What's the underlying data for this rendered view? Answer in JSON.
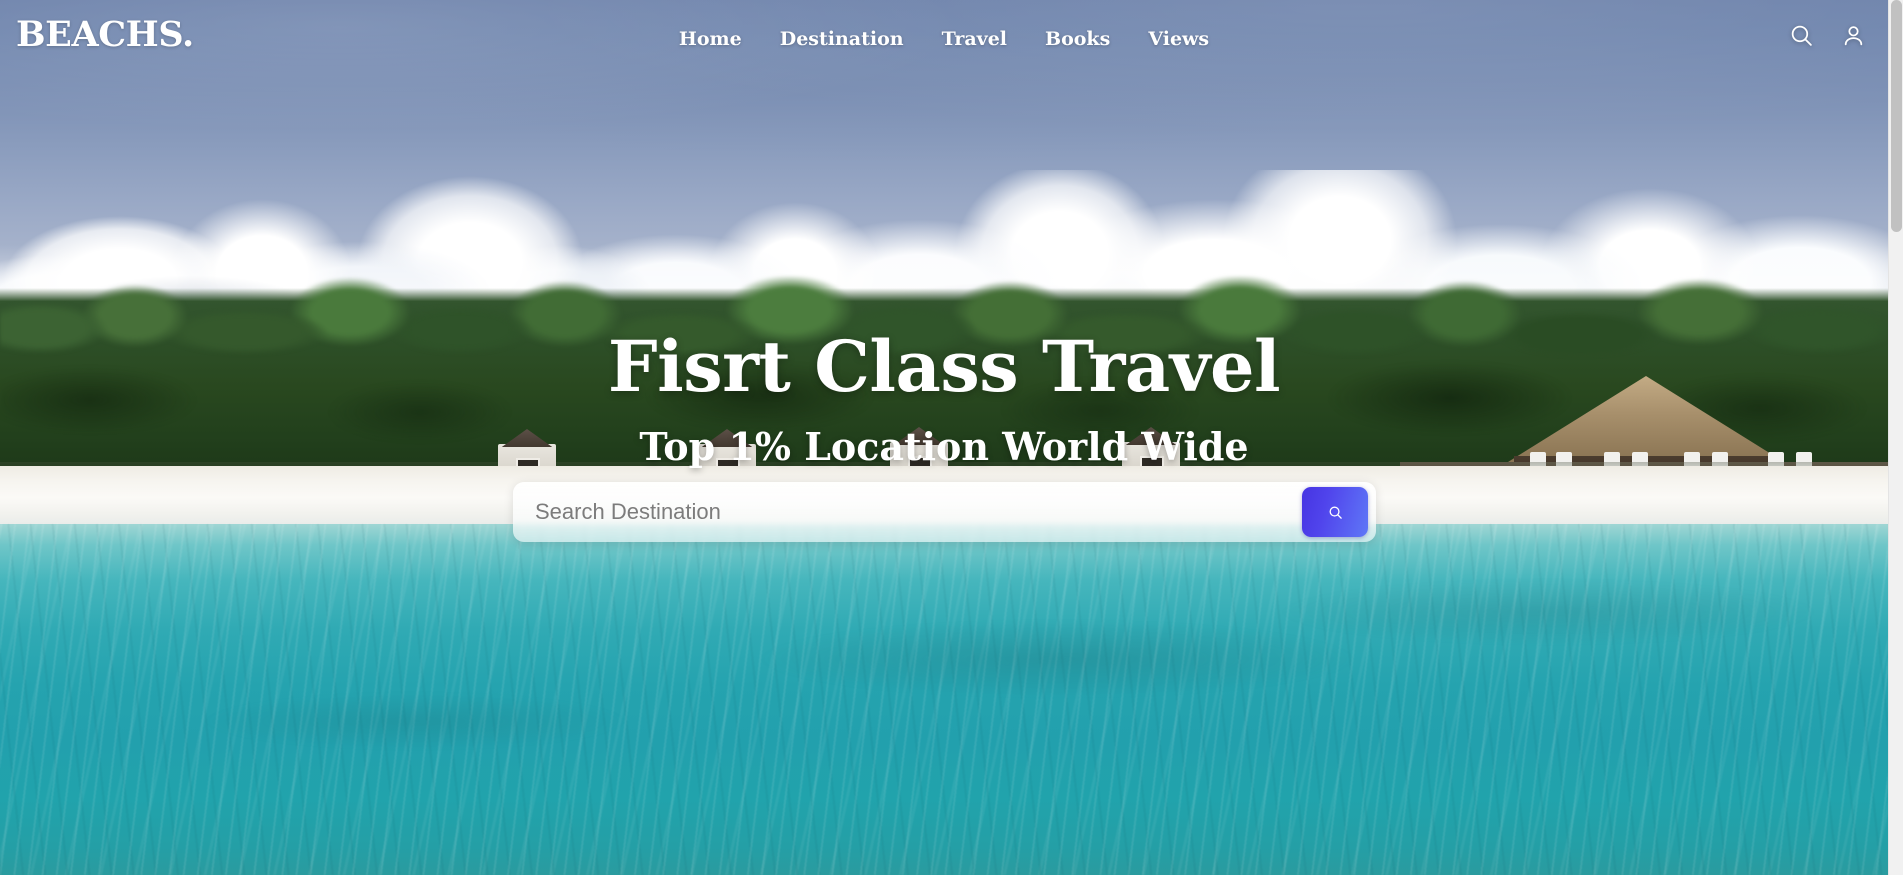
{
  "site": {
    "logo": "BEACHS."
  },
  "nav": {
    "items": [
      {
        "label": "Home"
      },
      {
        "label": "Destination"
      },
      {
        "label": "Travel"
      },
      {
        "label": "Books"
      },
      {
        "label": "Views"
      }
    ],
    "icons": [
      {
        "name": "search-icon"
      },
      {
        "name": "user-account-icon"
      }
    ]
  },
  "hero": {
    "title": "Fisrt Class Travel",
    "subtitle": "Top 1% Location World Wide",
    "search": {
      "value": "",
      "placeholder": "Search Destination",
      "button_icon": "search-icon"
    }
  },
  "colors": {
    "accent_start": "#4634e2",
    "accent_end": "#5f77f7",
    "text_on_hero": "#ffffff",
    "placeholder": "#7c7c7c",
    "sky": "#6d82ab",
    "water": "#22a0ad",
    "sand": "#fbfaf7",
    "foliage": "#29481f",
    "scrollbar_track": "#f1f1f1",
    "scrollbar_thumb": "#c1c1c1"
  }
}
